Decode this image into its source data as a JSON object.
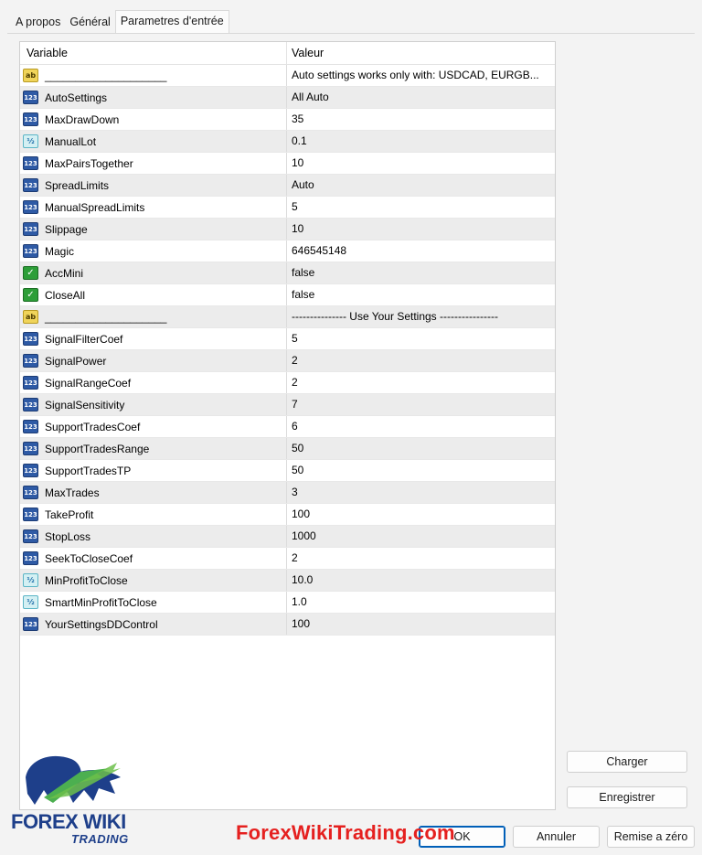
{
  "tabs": [
    {
      "label": "A propos"
    },
    {
      "label": "Général"
    },
    {
      "label": "Parametres d'entrée",
      "active": true
    }
  ],
  "grid": {
    "headers": {
      "variable": "Variable",
      "value": "Valeur"
    },
    "rows": [
      {
        "type": "string",
        "icon": "string-type-icon",
        "name": "____________________",
        "value": "Auto settings works only with: USDCAD, EURGB..."
      },
      {
        "type": "int",
        "icon": "integer-type-icon",
        "name": "AutoSettings",
        "value": "All Auto"
      },
      {
        "type": "int",
        "icon": "integer-type-icon",
        "name": "MaxDrawDown",
        "value": "35"
      },
      {
        "type": "double",
        "icon": "double-type-icon",
        "name": "ManualLot",
        "value": "0.1"
      },
      {
        "type": "int",
        "icon": "integer-type-icon",
        "name": "MaxPairsTogether",
        "value": "10"
      },
      {
        "type": "int",
        "icon": "integer-type-icon",
        "name": "SpreadLimits",
        "value": "Auto"
      },
      {
        "type": "int",
        "icon": "integer-type-icon",
        "name": "ManualSpreadLimits",
        "value": "5"
      },
      {
        "type": "int",
        "icon": "integer-type-icon",
        "name": "Slippage",
        "value": "10"
      },
      {
        "type": "int",
        "icon": "integer-type-icon",
        "name": "Magic",
        "value": "646545148"
      },
      {
        "type": "bool",
        "icon": "boolean-type-icon",
        "name": "AccMini",
        "value": "false"
      },
      {
        "type": "bool",
        "icon": "boolean-type-icon",
        "name": "CloseAll",
        "value": "false"
      },
      {
        "type": "string",
        "icon": "string-type-icon",
        "name": "____________________",
        "value": "---------------  Use Your Settings ----------------"
      },
      {
        "type": "int",
        "icon": "integer-type-icon",
        "name": "SignalFilterCoef",
        "value": "5"
      },
      {
        "type": "int",
        "icon": "integer-type-icon",
        "name": "SignalPower",
        "value": "2"
      },
      {
        "type": "int",
        "icon": "integer-type-icon",
        "name": "SignalRangeCoef",
        "value": "2"
      },
      {
        "type": "int",
        "icon": "integer-type-icon",
        "name": "SignalSensitivity",
        "value": "7"
      },
      {
        "type": "int",
        "icon": "integer-type-icon",
        "name": "SupportTradesCoef",
        "value": "6"
      },
      {
        "type": "int",
        "icon": "integer-type-icon",
        "name": "SupportTradesRange",
        "value": "50"
      },
      {
        "type": "int",
        "icon": "integer-type-icon",
        "name": "SupportTradesTP",
        "value": "50"
      },
      {
        "type": "int",
        "icon": "integer-type-icon",
        "name": "MaxTrades",
        "value": "3"
      },
      {
        "type": "int",
        "icon": "integer-type-icon",
        "name": "TakeProfit",
        "value": "100"
      },
      {
        "type": "int",
        "icon": "integer-type-icon",
        "name": "StopLoss",
        "value": "1000"
      },
      {
        "type": "int",
        "icon": "integer-type-icon",
        "name": "SeekToCloseCoef",
        "value": "2"
      },
      {
        "type": "double",
        "icon": "double-type-icon",
        "name": "MinProfitToClose",
        "value": "10.0"
      },
      {
        "type": "double",
        "icon": "double-type-icon",
        "name": "SmartMinProfitToClose",
        "value": "1.0"
      },
      {
        "type": "int",
        "icon": "integer-type-icon",
        "name": "YourSettingsDDControl",
        "value": "100"
      }
    ]
  },
  "type_icons": {
    "int": "123",
    "double": "½",
    "bool": "✓",
    "string": "ab"
  },
  "buttons": {
    "load": "Charger",
    "save": "Enregistrer",
    "ok": "OK",
    "cancel": "Annuler",
    "reset": "Remise a zéro"
  },
  "logo": {
    "line1": "FOREX WIKI",
    "line2": "TRADING",
    "icon": "bull-bear-logo-icon"
  },
  "watermark": "ForexWikiTrading.com",
  "colors": {
    "accent": "#005fb8",
    "watermark": "#e5201f",
    "logo_blue": "#1e3f8a",
    "logo_green": "#4caf50"
  }
}
